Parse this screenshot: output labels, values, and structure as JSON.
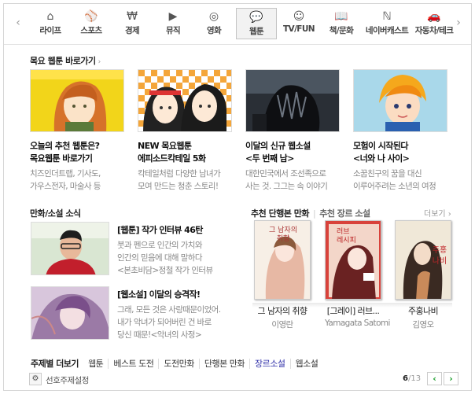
{
  "nav": {
    "prev": "‹",
    "next": "›",
    "tabs": [
      {
        "label": "라이프",
        "icon": "⌂"
      },
      {
        "label": "스포츠",
        "icon": "⚾"
      },
      {
        "label": "경제",
        "icon": "₩"
      },
      {
        "label": "뮤직",
        "icon": "▶"
      },
      {
        "label": "영화",
        "icon": "◎"
      },
      {
        "label": "웹툰",
        "icon": "💬"
      },
      {
        "label": "TV/FUN",
        "icon": "☺"
      },
      {
        "label": "책/문화",
        "icon": "📖"
      },
      {
        "label": "네이버캐스트",
        "icon": "ℕ"
      },
      {
        "label": "자동차/테크",
        "icon": "🚗"
      }
    ]
  },
  "webtoon": {
    "title": "목요 웹툰 바로가기",
    "caret": "›",
    "cards": [
      {
        "line1": "오늘의 추천 웹툰은?",
        "line2": "목요웹툰 바로가기",
        "desc1": "치즈인더트랩, 기사도,",
        "desc2": "가우스전자, 마술사 등"
      },
      {
        "line1": "NEW 목요웹툰",
        "line2": "에피소드칵테일 5화",
        "desc1": "칵테일처럼 다양한 남녀가",
        "desc2": "모여 만드는 청춘 스토리!"
      },
      {
        "line1": "이달의 신규 웹소설",
        "line2": "<두 번째 남>",
        "desc1": "대한민국에서 조선족으로",
        "desc2": "사는 것. 그그는 속 이야기"
      },
      {
        "line1": "모험이 시작된다",
        "line2": "<너와 나 사이>",
        "desc1": "소꿉친구의 꿈을 대신",
        "desc2": "이루어주려는 소년의 여정"
      }
    ]
  },
  "news": {
    "title": "만화/소설 소식",
    "items": [
      {
        "title": "[웹툰] 작가 인터뷰 46탄",
        "l1": "붓과 펜으로 인간의 가치와",
        "l2": "인간의 믿음에 대해 말하다",
        "l3": "<본초비담>정철 작가 인터뷰"
      },
      {
        "title": "[웹소설] 이달의 승격작!",
        "l1": "그래, 모든 것은 사랑때문이었어.",
        "l2": "내가 악녀가 되어버린 건 바로",
        "l3": "당신 때문!<악녀의 사정>"
      }
    ]
  },
  "recommend": {
    "title": "추천 단행본 만화",
    "sep": "|",
    "alt": "추천 장르 소설",
    "more": "더보기 ›",
    "books": [
      {
        "title": "그 남자의 취향",
        "author": "이영란",
        "cover": "그 남자의\n취향"
      },
      {
        "title": "[그레이] 러브...",
        "author": "Yamagata Satomi",
        "cover": "러브\n레시피"
      },
      {
        "title": "주홍나비",
        "author": "김영오",
        "cover": "주홍\n나비"
      }
    ]
  },
  "footer": {
    "title": "주제별 더보기",
    "items": [
      "웹툰",
      "베스트 도전",
      "도전만화",
      "단행본 만화",
      "장르소설",
      "웹소설"
    ],
    "pref": "선호주제설정",
    "page_current": "6",
    "page_total": "/13",
    "prev": "‹",
    "next": "›"
  },
  "colors": {
    "accent": "#1a9e2c",
    "link": "#3333aa"
  }
}
